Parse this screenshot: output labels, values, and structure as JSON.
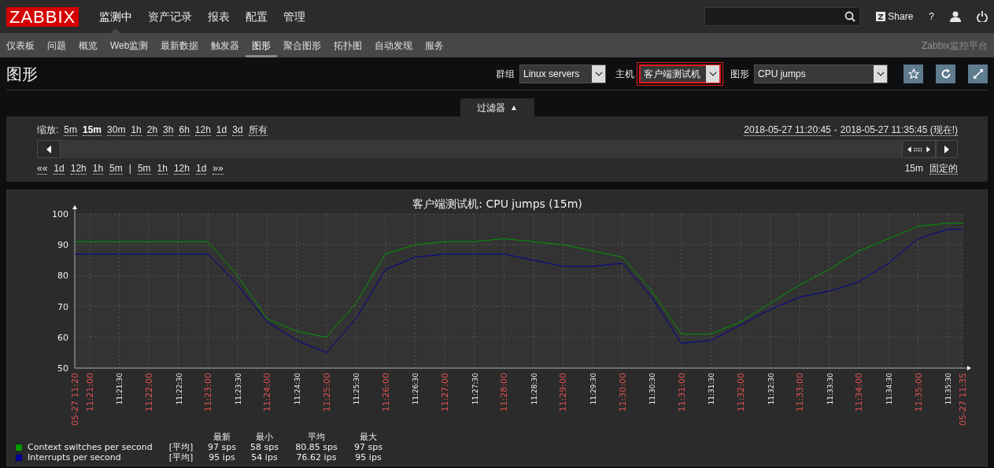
{
  "logo": "ZABBIX",
  "main_menu": [
    {
      "label": "监测中",
      "selected": true
    },
    {
      "label": "资产记录",
      "selected": false
    },
    {
      "label": "报表",
      "selected": false
    },
    {
      "label": "配置",
      "selected": false
    },
    {
      "label": "管理",
      "selected": false
    }
  ],
  "share_button": "Share",
  "help_button": "?",
  "sub_menu": [
    {
      "label": "仪表板",
      "selected": false
    },
    {
      "label": "问题",
      "selected": false
    },
    {
      "label": "概览",
      "selected": false
    },
    {
      "label": "Web监测",
      "selected": false
    },
    {
      "label": "最新数据",
      "selected": false
    },
    {
      "label": "触发器",
      "selected": false
    },
    {
      "label": "图形",
      "selected": true
    },
    {
      "label": "聚合图形",
      "selected": false
    },
    {
      "label": "拓扑图",
      "selected": false
    },
    {
      "label": "自动发现",
      "selected": false
    },
    {
      "label": "服务",
      "selected": false
    }
  ],
  "brand_text": "Zabbix监控平台",
  "page_title": "图形",
  "selectors": [
    {
      "label": "群组",
      "value": "Linux servers",
      "highlighted": false
    },
    {
      "label": "主机",
      "value": "客户端测试机",
      "highlighted": true
    },
    {
      "label": "图形",
      "value": "CPU jumps",
      "highlighted": false
    }
  ],
  "filter": {
    "tab_label": "过滤器",
    "tab_icon": "▲",
    "expanded": true,
    "zoom_label": "缩放:",
    "zoom_options": [
      {
        "label": "5m",
        "selected": false
      },
      {
        "label": "15m",
        "selected": true
      },
      {
        "label": "30m",
        "selected": false
      },
      {
        "label": "1h",
        "selected": false
      },
      {
        "label": "2h",
        "selected": false
      },
      {
        "label": "3h",
        "selected": false
      },
      {
        "label": "6h",
        "selected": false
      },
      {
        "label": "12h",
        "selected": false
      },
      {
        "label": "1d",
        "selected": false
      },
      {
        "label": "3d",
        "selected": false
      },
      {
        "label": "所有",
        "selected": false
      }
    ],
    "time_from": "2018-05-27 11:20:45",
    "time_separator": "-",
    "time_to": "2018-05-27 11:35:45 (现在!)",
    "nav_back": [
      "««",
      "1d",
      "12h",
      "1h",
      "5m"
    ],
    "nav_divider": "|",
    "nav_forward": [
      "5m",
      "1h",
      "12h",
      "1d",
      "»»"
    ],
    "period": "15m",
    "fixed_link": "固定的"
  },
  "graph": {
    "chart_data": {
      "type": "line",
      "title": "客户端测试机: CPU jumps (15m)",
      "categories": [
        "05-27 11:20",
        "11:21:00",
        "11:21:30",
        "11:22:00",
        "11:22:30",
        "11:23:00",
        "11:23:30",
        "11:24:00",
        "11:24:30",
        "11:25:00",
        "11:25:30",
        "11:26:00",
        "11:26:30",
        "11:27:00",
        "11:27:30",
        "11:28:00",
        "11:28:30",
        "11:29:00",
        "11:29:30",
        "11:30:00",
        "11:30:30",
        "11:31:00",
        "11:31:30",
        "11:32:00",
        "11:32:30",
        "11:33:00",
        "11:33:30",
        "11:34:00",
        "11:34:30",
        "11:35:00",
        "11:35:30",
        "05-27 11:35"
      ],
      "ylim": [
        50,
        100
      ],
      "grid": true,
      "yticks": [
        50,
        60,
        70,
        80,
        90,
        100
      ],
      "series": [
        {
          "name": "Context switches per second",
          "color": "#009900",
          "values": [
            91,
            91,
            91,
            91,
            91,
            91,
            80,
            66,
            62,
            60,
            71,
            87,
            90,
            91,
            91,
            92,
            91,
            90,
            88,
            86,
            75,
            61,
            61,
            65,
            71,
            77,
            82,
            88,
            92,
            96,
            97,
            97
          ]
        },
        {
          "name": "Interrupts per second",
          "color": "#000099",
          "values": [
            87,
            87,
            87,
            87,
            87,
            87,
            77,
            65,
            59,
            55,
            66,
            82,
            86,
            87,
            87,
            87,
            85,
            83,
            83,
            84,
            73,
            58,
            59,
            64,
            69,
            73,
            75,
            78,
            84,
            92,
            95,
            95
          ]
        }
      ]
    },
    "legend": {
      "columns": [
        "最新",
        "最小",
        "平均",
        "最大"
      ],
      "rows": [
        {
          "function": "[平均]",
          "values": [
            "97 sps",
            "58 sps",
            "80.85 sps",
            "97 sps"
          ]
        },
        {
          "function": "[平均]",
          "values": [
            "95 ips",
            "54 ips",
            "76.62 ips",
            "95 ips"
          ]
        }
      ]
    }
  }
}
